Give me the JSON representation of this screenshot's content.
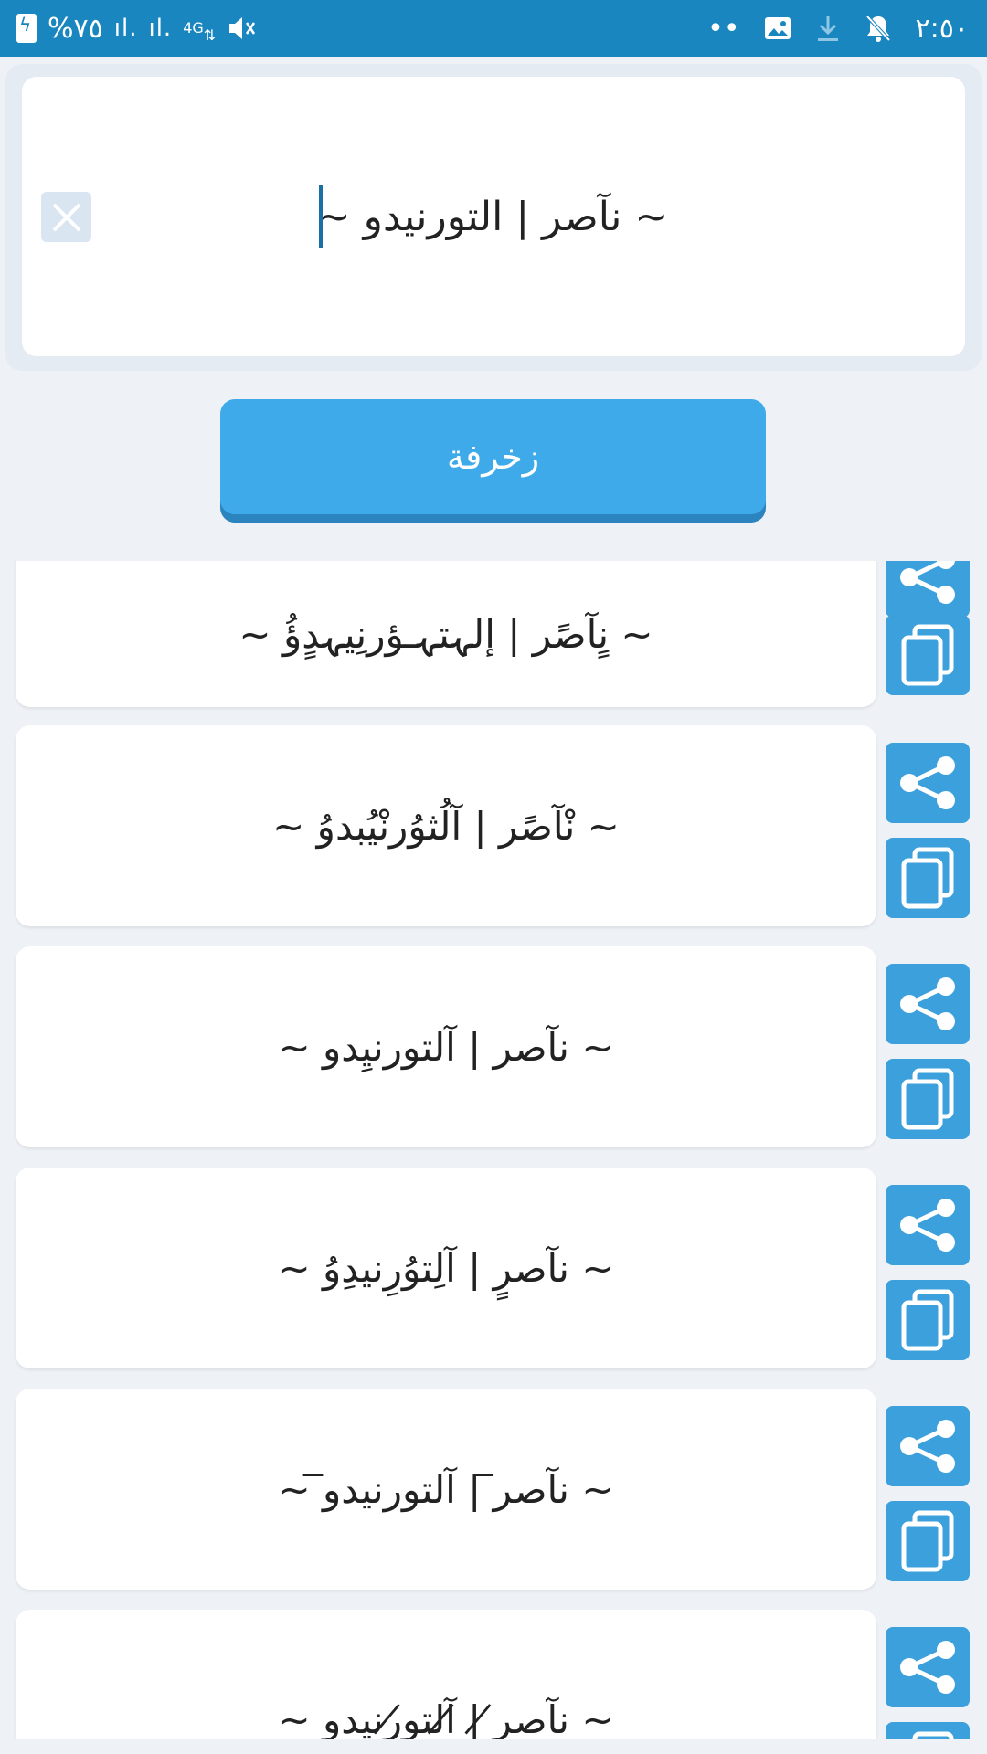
{
  "status_bar": {
    "battery_percent": "%٧٥",
    "network": "4G",
    "time": "٢:٥٠",
    "dots": "••"
  },
  "input": {
    "value": "~ نآصر | التورنيدو ~"
  },
  "decorate_button": {
    "label": "زخرفة"
  },
  "results": [
    "~ نٍآصًر | إلہتہـؤرنِيہدٍؤُ ~",
    "~ نْآصًر | آلُثوُرنْيُبدوُ ~",
    "~ نآصر | آلتورنيِدو ~",
    "~ نآصرٍ | آلِتوُرِنيدِوُ ~",
    "~ نآصر̅ | آلتورنيدو̅ ~",
    "~ نآصر̸ | ̸آلتو̸رنيدو ~"
  ],
  "colors": {
    "status_bar": "#1a86bf",
    "accent": "#3eaae9",
    "action_button": "#3ca0dc"
  },
  "icons": {
    "share": "share-icon",
    "copy": "copy-icon",
    "clear": "close-icon"
  }
}
